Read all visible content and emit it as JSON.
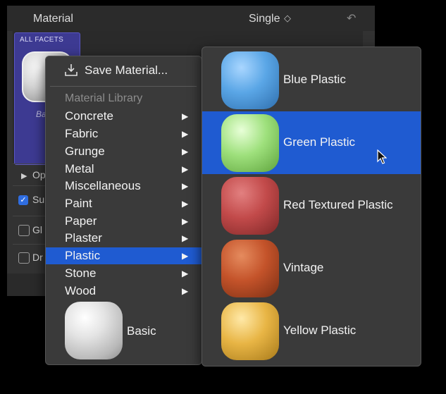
{
  "panel": {
    "title": "Material",
    "mode": "Single",
    "mode_chevron": "◇",
    "undo": "↶",
    "facet_tile": {
      "label": "ALL FACETS",
      "name": "Ba"
    },
    "options_label": "Op",
    "rows": [
      {
        "label": "Su",
        "checked": true
      },
      {
        "label": "Gl",
        "checked": false
      },
      {
        "label": "Dr",
        "checked": false
      }
    ]
  },
  "menu": {
    "save_label": "Save Material...",
    "save_icon": "save-tray-icon",
    "section_header": "Material Library",
    "items": [
      {
        "label": "Concrete",
        "arrow": "▶"
      },
      {
        "label": "Fabric",
        "arrow": "▶"
      },
      {
        "label": "Grunge",
        "arrow": "▶"
      },
      {
        "label": "Metal",
        "arrow": "▶"
      },
      {
        "label": "Miscellaneous",
        "arrow": "▶"
      },
      {
        "label": "Paint",
        "arrow": "▶"
      },
      {
        "label": "Paper",
        "arrow": "▶"
      },
      {
        "label": "Plaster",
        "arrow": "▶"
      },
      {
        "label": "Plastic",
        "arrow": "▶",
        "selected": true
      },
      {
        "label": "Stone",
        "arrow": "▶"
      },
      {
        "label": "Wood",
        "arrow": "▶"
      }
    ],
    "basic_label": "Basic"
  },
  "submenu": {
    "items": [
      {
        "label": "Blue Plastic",
        "color": "#5aa6e6"
      },
      {
        "label": "Green Plastic",
        "color": "#9ee07c",
        "selected": true
      },
      {
        "label": "Red Textured Plastic",
        "color": "#c24a4a"
      },
      {
        "label": "Vintage",
        "color": "#c4532a"
      },
      {
        "label": "Yellow Plastic",
        "color": "#e8b545"
      }
    ]
  },
  "colors": {
    "selection": "#1f5bd1",
    "menu_bg": "#3a3a3a",
    "facet_tile": "#3d3a92"
  }
}
